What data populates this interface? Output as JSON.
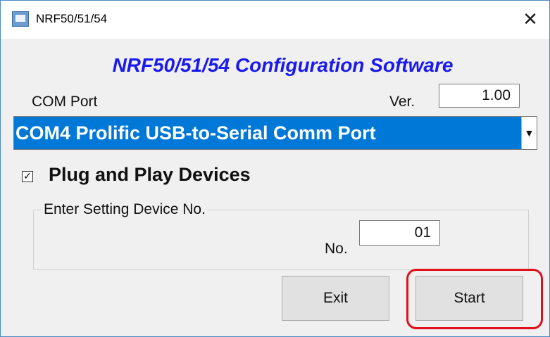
{
  "window": {
    "title": "NRF50/51/54",
    "close_glyph": "✕",
    "app_icon": "app-monitor-icon"
  },
  "main": {
    "heading": "NRF50/51/54 Configuration Software",
    "com_port_label": "COM Port",
    "ver_label": "Ver.",
    "ver_value": "1.00",
    "com_port_selected": "COM4 Prolific USB-to-Serial Comm Port",
    "dropdown_glyph": "▼",
    "plug_and_play": {
      "label": "Plug and Play Devices",
      "checked": true,
      "check_glyph": "✓"
    },
    "device_group": {
      "legend": "Enter Setting Device No.",
      "no_label": "No.",
      "no_value": "01"
    },
    "buttons": {
      "exit": "Exit",
      "start": "Start"
    },
    "highlight_color": "#e0101a",
    "accent_color": "#0078d7",
    "heading_color": "#1a1aee"
  }
}
